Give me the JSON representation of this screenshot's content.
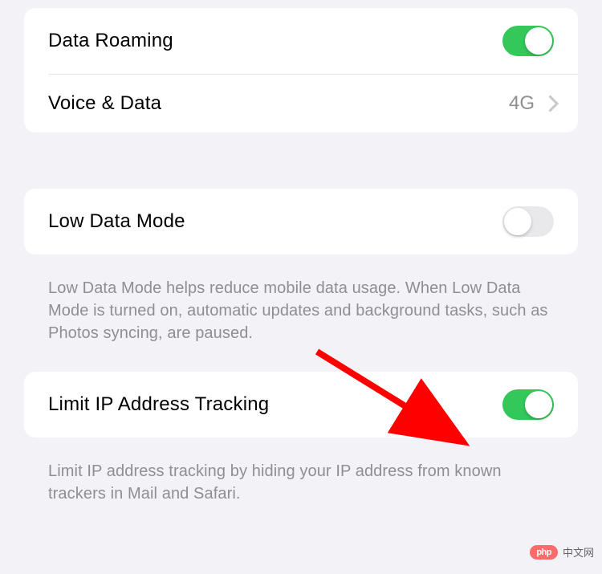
{
  "group1": {
    "data_roaming": {
      "label": "Data Roaming",
      "toggle": "on"
    },
    "voice_data": {
      "label": "Voice & Data",
      "value": "4G"
    }
  },
  "group2": {
    "low_data_mode": {
      "label": "Low Data Mode",
      "toggle": "off"
    },
    "footer": "Low Data Mode helps reduce mobile data usage. When Low Data Mode is turned on, automatic updates and background tasks, such as Photos syncing, are paused."
  },
  "group3": {
    "limit_ip": {
      "label": "Limit IP Address Tracking",
      "toggle": "on"
    },
    "footer": "Limit IP address tracking by hiding your IP address from known trackers in Mail and Safari."
  },
  "watermark": {
    "badge": "php",
    "text": "中文网"
  },
  "colors": {
    "toggle_on": "#34c759",
    "toggle_off": "#e9e9eb",
    "arrow": "#ff0000"
  }
}
